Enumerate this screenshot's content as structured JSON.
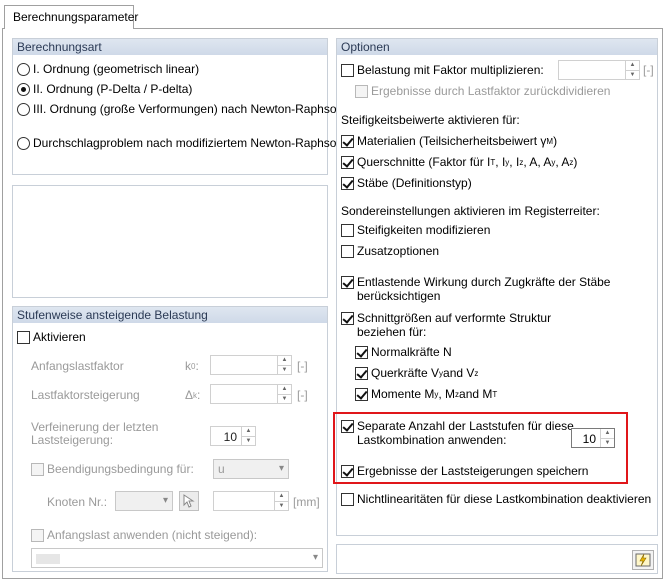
{
  "tab": {
    "label": "Berechnungsparameter"
  },
  "berechnungsart": {
    "title": "Berechnungsart",
    "options": [
      {
        "label": "I. Ordnung (geometrisch linear)",
        "selected": false
      },
      {
        "label": "II. Ordnung (P-Delta / P-delta)",
        "selected": true
      },
      {
        "label": "III. Ordnung (große Verformungen) nach Newton-Raphson",
        "selected": false
      },
      {
        "label": "Durchschlagproblem nach modifiziertem Newton-Raphson",
        "selected": false
      }
    ]
  },
  "stufenweise": {
    "title": "Stufenweise ansteigende Belastung",
    "aktivieren": "Aktivieren",
    "anfangslastfaktor": "Anfangslastfaktor",
    "anfangslastfaktor_symbol": "k",
    "anfangslastfaktor_sub": "0",
    "anfangslastfaktor_unit": "[-]",
    "lastfaktorsteigerung": "Lastfaktorsteigerung",
    "lastfaktorsteigerung_symbol": "Δ",
    "lastfaktorsteigerung_sub": "k",
    "lastfaktorsteigerung_unit": "[-]",
    "verfeinerung_line1": "Verfeinerung der letzten",
    "verfeinerung_line2": "Laststeigerung:",
    "verfeinerung_value": "10",
    "beendigung": "Beendigungsbedingung für:",
    "beendigung_value": "u",
    "knoten": "Knoten Nr.:",
    "knoten_unit": "[mm]",
    "anfangslast": "Anfangslast anwenden (nicht steigend):"
  },
  "optionen": {
    "title": "Optionen",
    "belastung": "Belastung mit Faktor multiplizieren:",
    "belastung_unit": "[-]",
    "ergebnisse_dividieren": "Ergebnisse durch Lastfaktor zurückdividieren",
    "steifigkeit_heading": "Steifigkeitsbeiwerte aktivieren für:",
    "materialien": "Materialien (Teilsicherheitsbeiwert γ",
    "materialien_sub": "M",
    "materialien_end": ")",
    "querschnitte": "Querschnitte (Faktor für I",
    "querschnitte_rest": [
      {
        "sub": "T",
        "text": ", I"
      },
      {
        "sub": "y",
        "text": ", I"
      },
      {
        "sub": "z",
        "text": ", A, A"
      },
      {
        "sub": "y",
        "text": ", A"
      },
      {
        "sub": "z",
        "text": ")"
      }
    ],
    "staebe": "Stäbe (Definitionstyp)",
    "sonder_heading": "Sondereinstellungen aktivieren im Registerreiter:",
    "steifigkeiten": "Steifigkeiten modifizieren",
    "zusatzoptionen": "Zusatzoptionen",
    "entlastend_line1": "Entlastende Wirkung durch Zugkräfte der Stäbe",
    "entlastend_line2": "berücksichtigen",
    "schnitt_line1": "Schnittgrößen auf verformte Struktur",
    "schnitt_line2": "beziehen für:",
    "normalkraefte": "Normalkräfte N",
    "querkraefte": "Querkräfte V",
    "querkraefte_sub1": "y",
    "querkraefte_mid": " and V",
    "querkraefte_sub2": "z",
    "momente": "Momente M",
    "momente_sub1": "y",
    "momente_mid1": ", M",
    "momente_sub2": "z",
    "momente_mid2": " and M",
    "momente_sub3": "T",
    "separate_line1": "Separate Anzahl der Laststufen für diese",
    "separate_line2": "Lastkombination anwenden:",
    "separate_value": "10",
    "ergebnisse_speichern": "Ergebnisse der Laststeigerungen speichern",
    "nichtlin": "Nichtlinearitäten für diese Lastkombination deaktivieren"
  },
  "colors": {
    "highlight": "#e0161a",
    "group_title": "#2b3a55"
  }
}
